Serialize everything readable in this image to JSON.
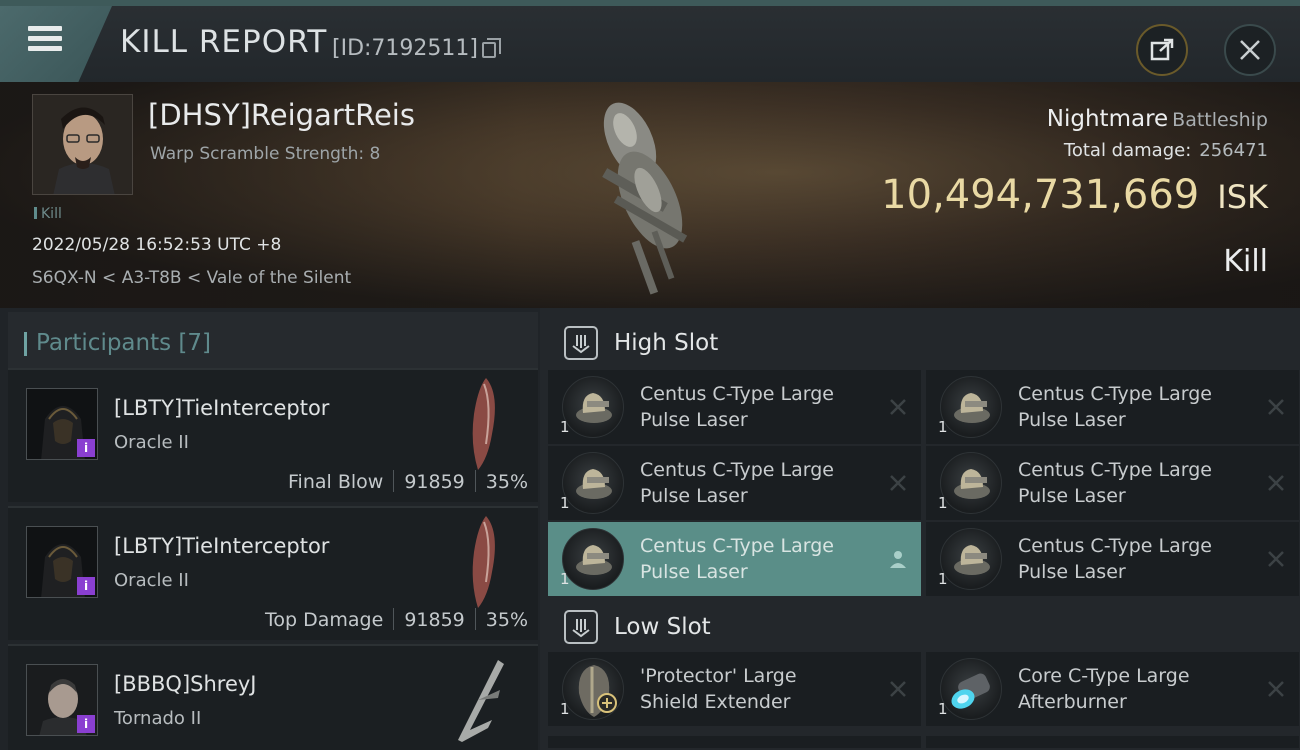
{
  "header": {
    "title": "KILL REPORT",
    "report_id": "[ID:7192511]"
  },
  "victim": {
    "name": "[DHSY]ReigartReis",
    "warp_scramble": "Warp Scramble Strength: 8",
    "tag": "Kill",
    "datetime": "2022/05/28 16:52:53 UTC +8",
    "location": "S6QX-N < A3-T8B < Vale of the Silent",
    "ship_name": "Nightmare",
    "ship_class": "Battleship",
    "total_damage_label": "Total damage:",
    "total_damage": "256471",
    "isk_value": "10,494,731,669",
    "isk_unit": "ISK",
    "result": "Kill"
  },
  "participants": {
    "title": "Participants",
    "count": "[7]",
    "list": [
      {
        "name": "[LBTY]TieInterceptor",
        "ship": "Oracle II",
        "role": "Final Blow",
        "damage": "91859",
        "percent": "35%"
      },
      {
        "name": "[LBTY]TieInterceptor",
        "ship": "Oracle II",
        "role": "Top Damage",
        "damage": "91859",
        "percent": "35%"
      },
      {
        "name": "[BBBQ]ShreyJ",
        "ship": "Tornado II"
      }
    ]
  },
  "slots": {
    "high": {
      "title": "High Slot",
      "modules": [
        {
          "line1": "Centus C-Type Large",
          "line2": "Pulse Laser",
          "qty": "1"
        },
        {
          "line1": "Centus C-Type Large",
          "line2": "Pulse Laser",
          "qty": "1"
        },
        {
          "line1": "Centus C-Type Large",
          "line2": "Pulse Laser",
          "qty": "1"
        },
        {
          "line1": "Centus C-Type Large",
          "line2": "Pulse Laser",
          "qty": "1"
        },
        {
          "line1": "Centus C-Type Large",
          "line2": "Pulse Laser",
          "qty": "1"
        },
        {
          "line1": "Centus C-Type Large",
          "line2": "Pulse Laser",
          "qty": "1"
        }
      ]
    },
    "low": {
      "title": "Low Slot",
      "modules": [
        {
          "line1": "'Protector' Large",
          "line2": "Shield Extender",
          "qty": "1"
        },
        {
          "line1": "Core C-Type Large",
          "line2": "Afterburner",
          "qty": "1"
        }
      ]
    }
  },
  "colors": {
    "accent": "#5f8a8c",
    "isk": "#e9d9a4",
    "active_row": "#5a8e88",
    "badge": "#8a3fd1"
  }
}
